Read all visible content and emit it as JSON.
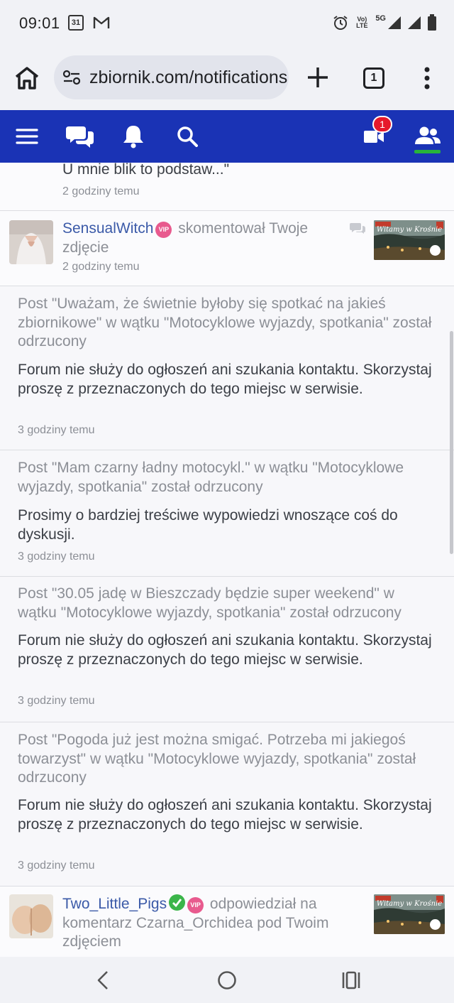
{
  "status_bar": {
    "time": "09:01",
    "calendar_day": "31",
    "network_label_top": "Vo)",
    "network_label_bottom": "LTE",
    "network_5g": "5G",
    "icons": [
      "calendar-icon",
      "gmail-icon",
      "alarm-icon",
      "volte-icon",
      "signal-icon",
      "battery-icon"
    ]
  },
  "browser": {
    "url": "zbiornik.com/notifications",
    "tab_count": "1"
  },
  "site_nav": {
    "messages_badge": "1",
    "icons": [
      "menu-icon",
      "chat-icon",
      "bell-icon",
      "search-icon",
      "video-icon",
      "friends-icon"
    ],
    "accent_color": "#1a33b5",
    "active_indicator_color": "#27b33b"
  },
  "notifications": [
    {
      "text": "U mnie blik to podstaw...\"",
      "time": "2 godziny temu"
    },
    {
      "user": "SensualWitch",
      "badge": "VIP",
      "action": " skomentował Twoje zdjęcie",
      "time": "2 godziny temu",
      "thumb_caption": "Witamy w Krośnie"
    },
    {
      "post": "Post \"Uważam, że świetnie byłoby się spotkać na jakieś zbiornikowe\" w wątku \"Motocyklowe wyjazdy, spotkania\" został odrzucony",
      "reason": "Forum nie służy do ogłoszeń ani szukania kontaktu. Skorzystaj proszę z przeznaczonych do tego miejsc w serwisie.",
      "time": "3 godziny temu"
    },
    {
      "post": "Post \"Mam czarny ładny motocykl.\" w wątku \"Motocyklowe wyjazdy, spotkania\" został odrzucony",
      "reason": "Prosimy o bardziej treściwe wypowiedzi wnoszące coś do dyskusji.",
      "time": "3 godziny temu"
    },
    {
      "post": "Post \"30.05 jadę w Bieszczady będzie super weekend\" w wątku \"Motocyklowe wyjazdy, spotkania\" został odrzucony",
      "reason": "Forum nie służy do ogłoszeń ani szukania kontaktu. Skorzystaj proszę z przeznaczonych do tego miejsc w serwisie.",
      "time": "3 godziny temu"
    },
    {
      "post": "Post \"Pogoda już jest można smigać. Potrzeba mi jakiegoś towarzyst\" w wątku \"Motocyklowe wyjazdy, spotkania\" został odrzucony",
      "reason": "Forum nie służy do ogłoszeń ani szukania kontaktu. Skorzystaj proszę z przeznaczonych do tego miejsc w serwisie.",
      "time": "3 godziny temu"
    },
    {
      "user": "Two_Little_Pigs",
      "badge": "VIP",
      "action": " odpowiedział na komentarz Czarna_Orchidea pod Twoim zdjęciem",
      "thumb_caption": "Witamy w Krośnie"
    }
  ],
  "bottom_nav": {
    "icons": [
      "back-icon",
      "home-circle-icon",
      "recents-icon"
    ]
  }
}
